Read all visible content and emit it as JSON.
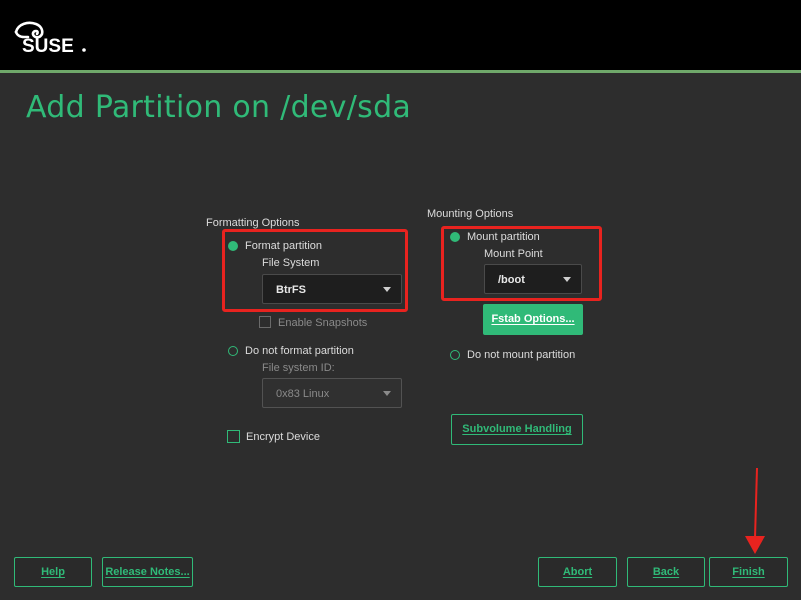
{
  "header": {
    "logo_text": "SUSE"
  },
  "page_title": "Add Partition on /dev/sda",
  "formatting": {
    "section_label": "Formatting Options",
    "format_partition_label": "Format partition",
    "file_system_label": "File System",
    "file_system_value": "BtrFS",
    "enable_snapshots_label": "Enable Snapshots",
    "do_not_format_label": "Do not format partition",
    "file_system_id_label": "File system ID:",
    "file_system_id_value": "0x83 Linux",
    "encrypt_device_label": "Encrypt Device",
    "selected": "format_partition"
  },
  "mounting": {
    "section_label": "Mounting Options",
    "mount_partition_label": "Mount partition",
    "mount_point_label": "Mount Point",
    "mount_point_value": "/boot",
    "fstab_options_label": "Fstab Options...",
    "do_not_mount_label": "Do not mount partition",
    "subvolume_handling_label": "Subvolume Handling",
    "selected": "mount_partition"
  },
  "footer": {
    "help_label": "Help",
    "release_notes_label": "Release Notes...",
    "abort_label": "Abort",
    "back_label": "Back",
    "finish_label": "Finish"
  },
  "colors": {
    "accent": "#30ba78",
    "background": "#2d2d2d",
    "header": "#000000",
    "highlight": "#e8231f"
  }
}
